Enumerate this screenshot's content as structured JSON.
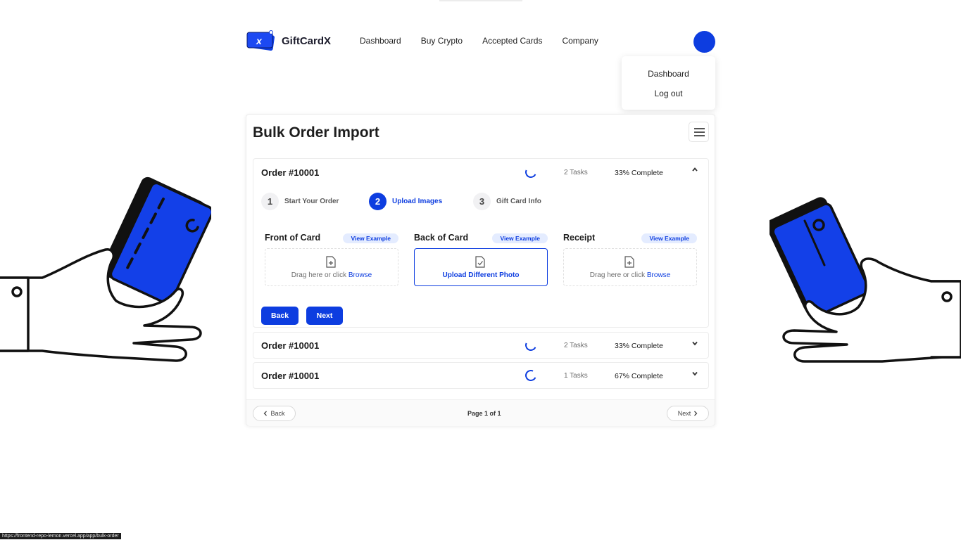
{
  "brand": {
    "name": "GiftCardX",
    "logo_letter": "x"
  },
  "nav": {
    "items": [
      "Dashboard",
      "Buy Crypto",
      "Accepted Cards",
      "Company"
    ]
  },
  "user_menu": {
    "items": [
      "Dashboard",
      "Log out"
    ]
  },
  "page": {
    "title": "Bulk Order Import"
  },
  "orders": [
    {
      "title": "Order #10001",
      "tasks": "2 Tasks",
      "complete": "33% Complete",
      "expanded": true
    },
    {
      "title": "Order #10001",
      "tasks": "2 Tasks",
      "complete": "33% Complete",
      "expanded": false
    },
    {
      "title": "Order #10001",
      "tasks": "1 Tasks",
      "complete": "67% Complete",
      "expanded": false
    }
  ],
  "steps": [
    {
      "number": "1",
      "label": "Start Your Order",
      "active": false
    },
    {
      "number": "2",
      "label": "Upload Images",
      "active": true
    },
    {
      "number": "3",
      "label": "Gift Card Info",
      "active": false
    }
  ],
  "uploads": [
    {
      "title": "Front of Card",
      "view_example": "View Example",
      "drop_text": "Drag here or click",
      "browse": "Browse"
    },
    {
      "title": "Back of Card",
      "view_example": "View Example",
      "uploaded_text": "Upload Different Photo"
    },
    {
      "title": "Receipt",
      "view_example": "View Example",
      "drop_text": "Drag here or click",
      "browse": "Browse"
    }
  ],
  "actions": {
    "back": "Back",
    "next": "Next"
  },
  "pagination": {
    "back": "Back",
    "next": "Next",
    "info": "Page 1 of 1"
  },
  "status_bar": {
    "url": "https://frontend-repo-lemon.vercel.app/app/bulk-order"
  },
  "colors": {
    "accent": "#0d3de0",
    "ink": "#1a1a1a"
  },
  "icons": [
    "logo-icon",
    "menu-icon",
    "spinner-icon",
    "chevron-up-icon",
    "chevron-down-icon",
    "file-plus-icon",
    "file-check-icon",
    "chevron-left-icon",
    "chevron-right-icon"
  ]
}
